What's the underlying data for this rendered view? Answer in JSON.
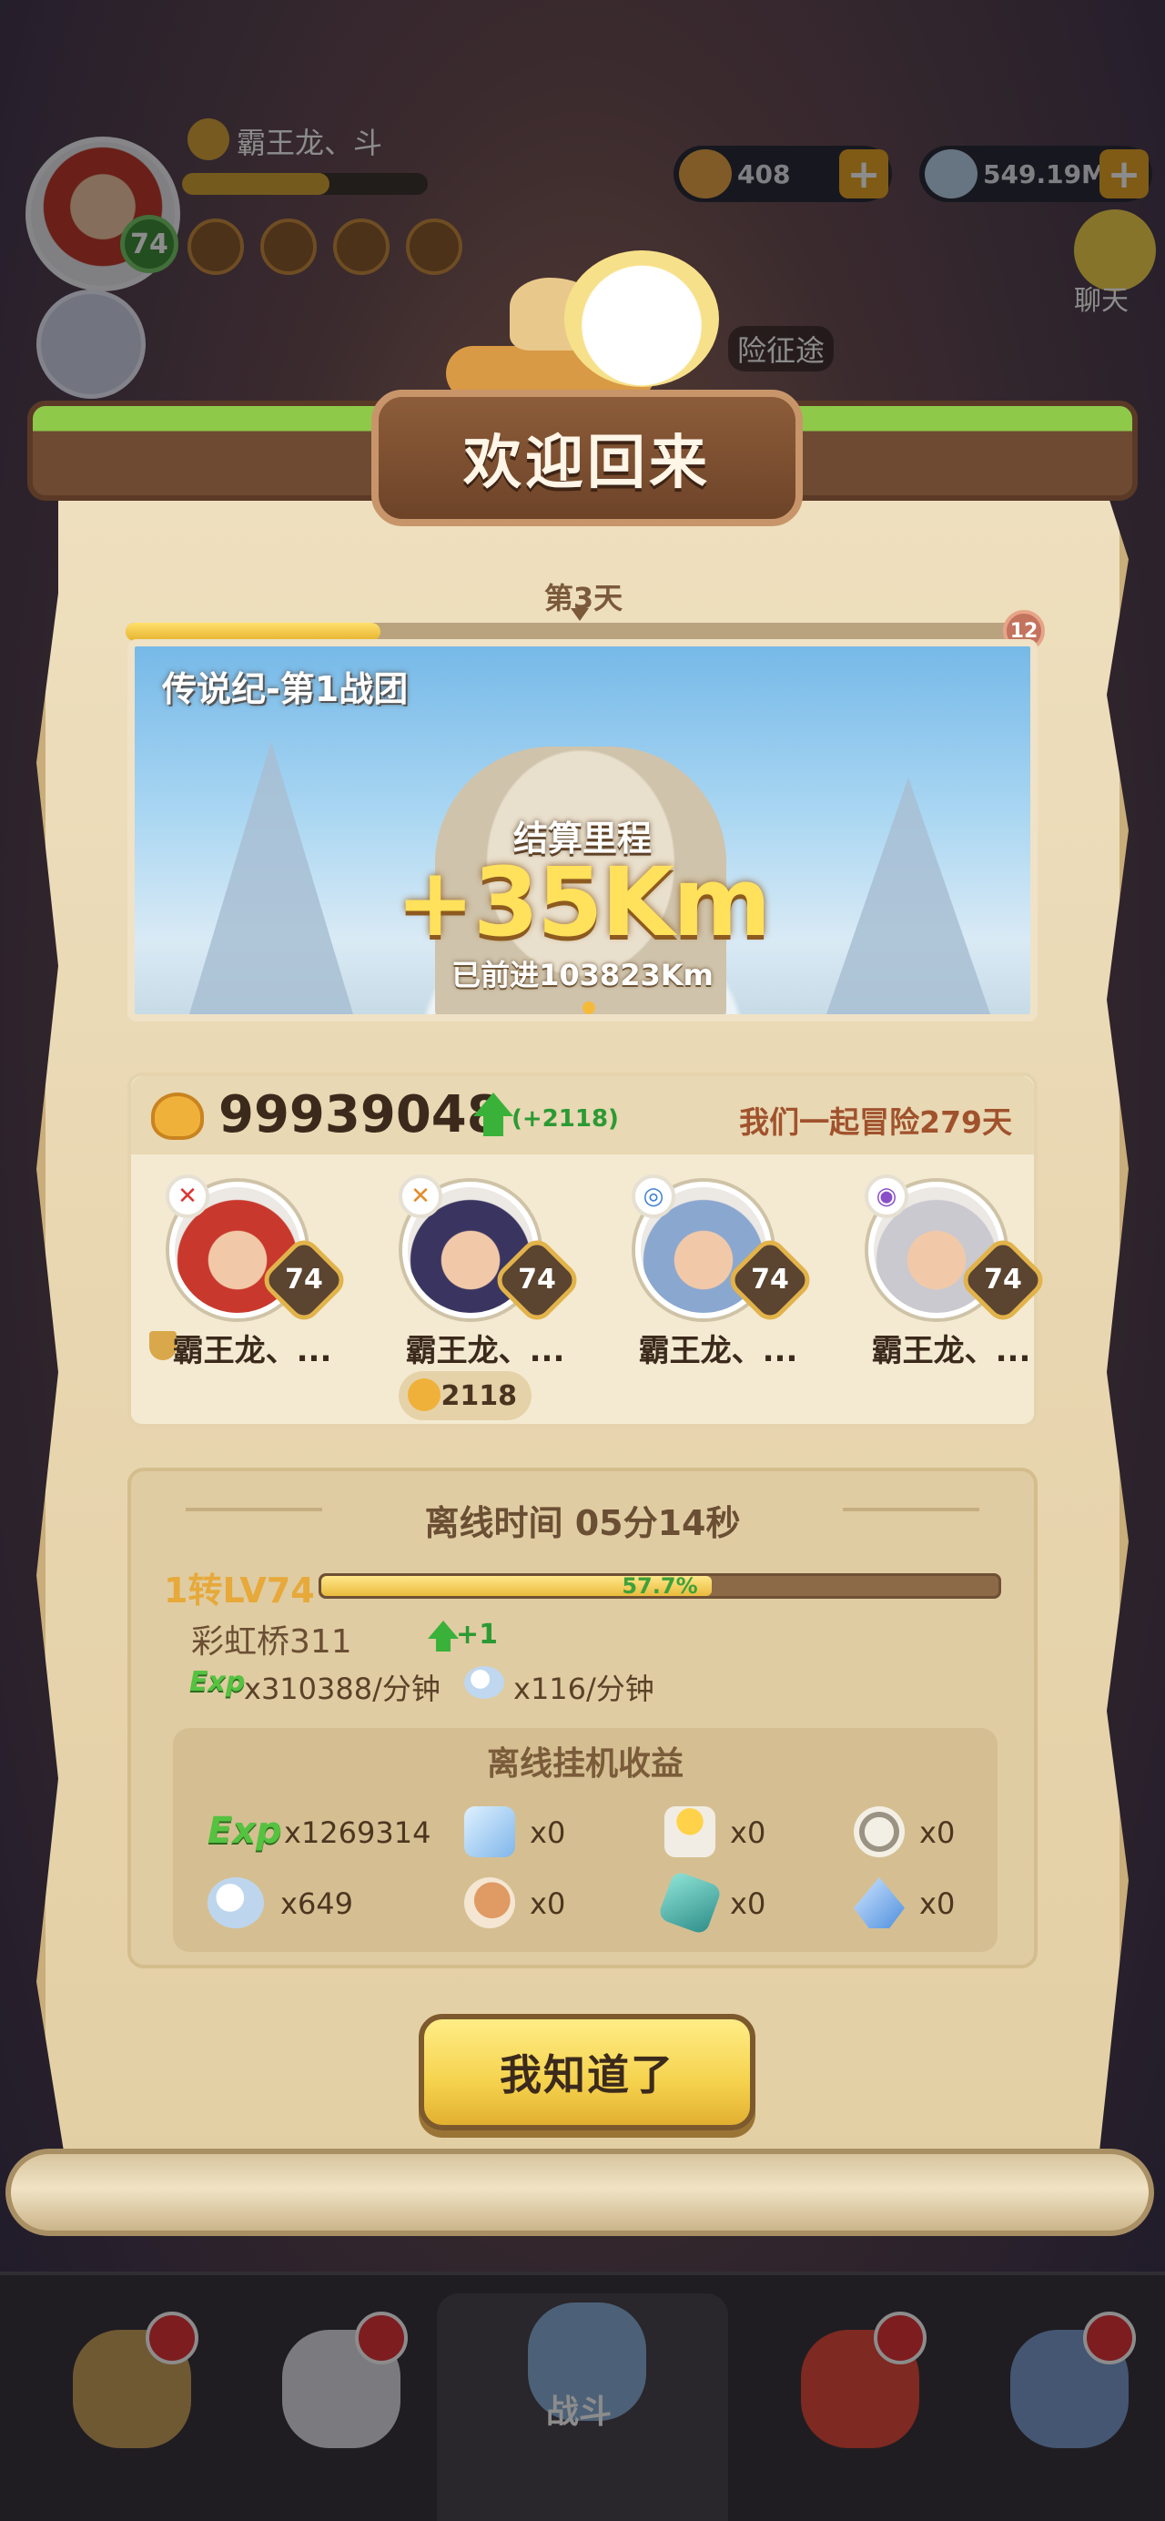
{
  "hud": {
    "player_name": "霸王龙、斗",
    "player_level": "74",
    "currency_food": "408",
    "currency_crystal": "549.19M",
    "chat_label": "聊天",
    "adventure_label": "险征途"
  },
  "modal": {
    "title": "欢迎回来",
    "day_label": "第3天",
    "day_end_value": "12",
    "day_progress": 0.28,
    "banner": {
      "team_name": "传说纪-第1战团",
      "settle_label": "结算里程",
      "distance_gain": "+35Km",
      "total_progress": "已前进103823Km"
    },
    "team": {
      "power": "99939048",
      "power_delta": "(+2118)",
      "days_together": "我们一起冒险279天",
      "heroes": [
        {
          "name": "霸王龙、...",
          "level": "74",
          "element": "fire",
          "color": "#c9382c"
        },
        {
          "name": "霸王龙、...",
          "level": "74",
          "element": "fire",
          "color": "#3a3560"
        },
        {
          "name": "霸王龙、...",
          "level": "74",
          "element": "water",
          "color": "#8aa7cf"
        },
        {
          "name": "霸王龙、...",
          "level": "74",
          "element": "void",
          "color": "#c9c9cf"
        }
      ],
      "hero_bonus": "+2118"
    },
    "offline": {
      "title": "离线时间 05分14秒",
      "level_label": "1转LV74",
      "level_pct_text": "57.7%",
      "level_progress": 0.577,
      "stage_name": "彩虹桥311",
      "stage_delta": "+1",
      "exp_tag": "Exp",
      "rate_exp": "x310388/分钟",
      "rate_crystal": "x116/分钟",
      "rewards_title": "离线挂机收益",
      "rewards": [
        {
          "icon": "exp-icon",
          "count": "x1269314"
        },
        {
          "icon": "ice-cube-icon",
          "count": "x0"
        },
        {
          "icon": "candle-icon",
          "count": "x0"
        },
        {
          "icon": "gear-stone-icon",
          "count": "x0"
        },
        {
          "icon": "crystal-icon",
          "count": "x649"
        },
        {
          "icon": "meat-icon",
          "count": "x0"
        },
        {
          "icon": "gem-icon",
          "count": "x0"
        },
        {
          "icon": "shard-icon",
          "count": "x0"
        }
      ]
    },
    "confirm_label": "我知道了"
  },
  "nav": {
    "battle_label": "战斗"
  }
}
